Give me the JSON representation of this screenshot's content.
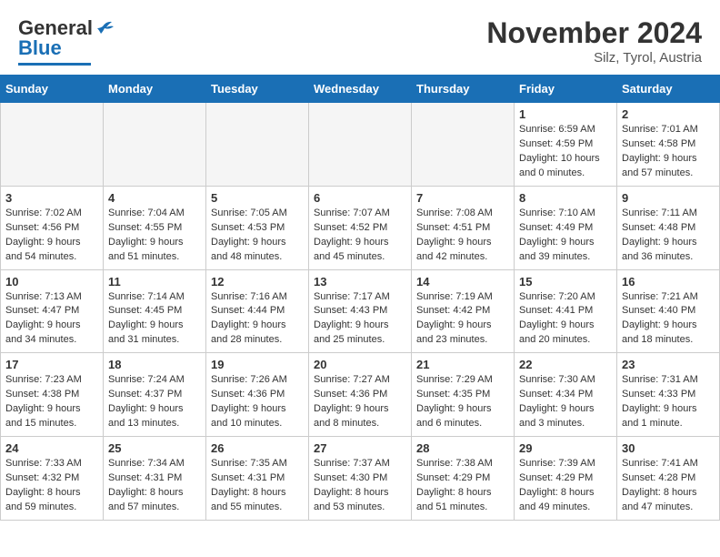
{
  "header": {
    "logo_general": "General",
    "logo_blue": "Blue",
    "month_year": "November 2024",
    "location": "Silz, Tyrol, Austria"
  },
  "weekdays": [
    "Sunday",
    "Monday",
    "Tuesday",
    "Wednesday",
    "Thursday",
    "Friday",
    "Saturday"
  ],
  "weeks": [
    [
      {
        "day": "",
        "info": ""
      },
      {
        "day": "",
        "info": ""
      },
      {
        "day": "",
        "info": ""
      },
      {
        "day": "",
        "info": ""
      },
      {
        "day": "",
        "info": ""
      },
      {
        "day": "1",
        "info": "Sunrise: 6:59 AM\nSunset: 4:59 PM\nDaylight: 10 hours\nand 0 minutes."
      },
      {
        "day": "2",
        "info": "Sunrise: 7:01 AM\nSunset: 4:58 PM\nDaylight: 9 hours\nand 57 minutes."
      }
    ],
    [
      {
        "day": "3",
        "info": "Sunrise: 7:02 AM\nSunset: 4:56 PM\nDaylight: 9 hours\nand 54 minutes."
      },
      {
        "day": "4",
        "info": "Sunrise: 7:04 AM\nSunset: 4:55 PM\nDaylight: 9 hours\nand 51 minutes."
      },
      {
        "day": "5",
        "info": "Sunrise: 7:05 AM\nSunset: 4:53 PM\nDaylight: 9 hours\nand 48 minutes."
      },
      {
        "day": "6",
        "info": "Sunrise: 7:07 AM\nSunset: 4:52 PM\nDaylight: 9 hours\nand 45 minutes."
      },
      {
        "day": "7",
        "info": "Sunrise: 7:08 AM\nSunset: 4:51 PM\nDaylight: 9 hours\nand 42 minutes."
      },
      {
        "day": "8",
        "info": "Sunrise: 7:10 AM\nSunset: 4:49 PM\nDaylight: 9 hours\nand 39 minutes."
      },
      {
        "day": "9",
        "info": "Sunrise: 7:11 AM\nSunset: 4:48 PM\nDaylight: 9 hours\nand 36 minutes."
      }
    ],
    [
      {
        "day": "10",
        "info": "Sunrise: 7:13 AM\nSunset: 4:47 PM\nDaylight: 9 hours\nand 34 minutes."
      },
      {
        "day": "11",
        "info": "Sunrise: 7:14 AM\nSunset: 4:45 PM\nDaylight: 9 hours\nand 31 minutes."
      },
      {
        "day": "12",
        "info": "Sunrise: 7:16 AM\nSunset: 4:44 PM\nDaylight: 9 hours\nand 28 minutes."
      },
      {
        "day": "13",
        "info": "Sunrise: 7:17 AM\nSunset: 4:43 PM\nDaylight: 9 hours\nand 25 minutes."
      },
      {
        "day": "14",
        "info": "Sunrise: 7:19 AM\nSunset: 4:42 PM\nDaylight: 9 hours\nand 23 minutes."
      },
      {
        "day": "15",
        "info": "Sunrise: 7:20 AM\nSunset: 4:41 PM\nDaylight: 9 hours\nand 20 minutes."
      },
      {
        "day": "16",
        "info": "Sunrise: 7:21 AM\nSunset: 4:40 PM\nDaylight: 9 hours\nand 18 minutes."
      }
    ],
    [
      {
        "day": "17",
        "info": "Sunrise: 7:23 AM\nSunset: 4:38 PM\nDaylight: 9 hours\nand 15 minutes."
      },
      {
        "day": "18",
        "info": "Sunrise: 7:24 AM\nSunset: 4:37 PM\nDaylight: 9 hours\nand 13 minutes."
      },
      {
        "day": "19",
        "info": "Sunrise: 7:26 AM\nSunset: 4:36 PM\nDaylight: 9 hours\nand 10 minutes."
      },
      {
        "day": "20",
        "info": "Sunrise: 7:27 AM\nSunset: 4:36 PM\nDaylight: 9 hours\nand 8 minutes."
      },
      {
        "day": "21",
        "info": "Sunrise: 7:29 AM\nSunset: 4:35 PM\nDaylight: 9 hours\nand 6 minutes."
      },
      {
        "day": "22",
        "info": "Sunrise: 7:30 AM\nSunset: 4:34 PM\nDaylight: 9 hours\nand 3 minutes."
      },
      {
        "day": "23",
        "info": "Sunrise: 7:31 AM\nSunset: 4:33 PM\nDaylight: 9 hours\nand 1 minute."
      }
    ],
    [
      {
        "day": "24",
        "info": "Sunrise: 7:33 AM\nSunset: 4:32 PM\nDaylight: 8 hours\nand 59 minutes."
      },
      {
        "day": "25",
        "info": "Sunrise: 7:34 AM\nSunset: 4:31 PM\nDaylight: 8 hours\nand 57 minutes."
      },
      {
        "day": "26",
        "info": "Sunrise: 7:35 AM\nSunset: 4:31 PM\nDaylight: 8 hours\nand 55 minutes."
      },
      {
        "day": "27",
        "info": "Sunrise: 7:37 AM\nSunset: 4:30 PM\nDaylight: 8 hours\nand 53 minutes."
      },
      {
        "day": "28",
        "info": "Sunrise: 7:38 AM\nSunset: 4:29 PM\nDaylight: 8 hours\nand 51 minutes."
      },
      {
        "day": "29",
        "info": "Sunrise: 7:39 AM\nSunset: 4:29 PM\nDaylight: 8 hours\nand 49 minutes."
      },
      {
        "day": "30",
        "info": "Sunrise: 7:41 AM\nSunset: 4:28 PM\nDaylight: 8 hours\nand 47 minutes."
      }
    ]
  ]
}
